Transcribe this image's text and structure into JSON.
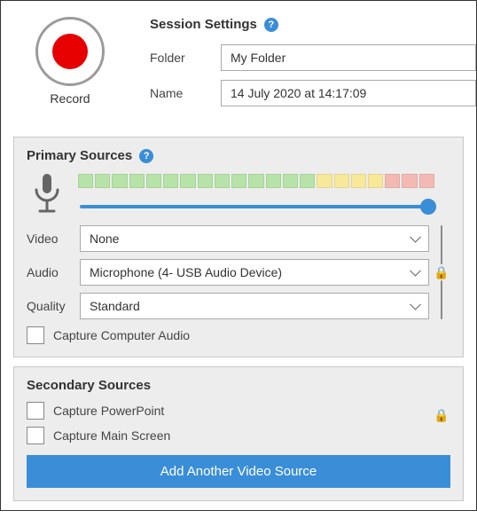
{
  "header": {
    "title": "Session Settings",
    "record_label": "Record",
    "folder_label": "Folder",
    "folder_value": "My Folder",
    "name_label": "Name",
    "name_value": "14 July 2020 at 14:17:09"
  },
  "primary": {
    "title": "Primary Sources",
    "video_label": "Video",
    "video_value": "None",
    "audio_label": "Audio",
    "audio_value": "Microphone (4- USB Audio Device)",
    "quality_label": "Quality",
    "quality_value": "Standard",
    "capture_audio_label": "Capture Computer Audio",
    "volume": 100,
    "meter": {
      "green": 14,
      "yellow": 4,
      "red": 3
    }
  },
  "secondary": {
    "title": "Secondary Sources",
    "capture_ppt_label": "Capture PowerPoint",
    "capture_screen_label": "Capture Main Screen",
    "add_button_label": "Add Another Video Source"
  },
  "icons": {
    "help": "?",
    "lock": "🔒"
  }
}
